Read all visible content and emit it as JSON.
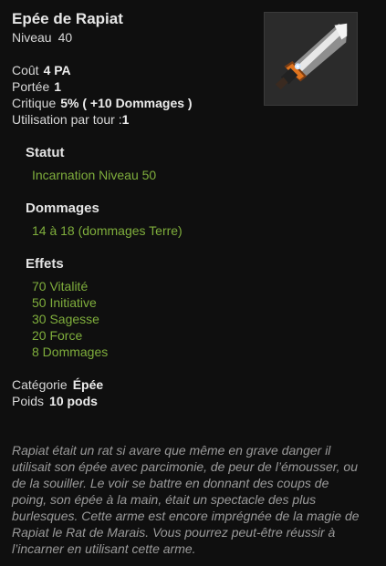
{
  "item": {
    "name": "Epée de Rapiat",
    "level_label": "Niveau",
    "level_value": "40",
    "image_icon": "sword-icon"
  },
  "stats": {
    "cost_label": "Coût",
    "cost_value": "4 PA",
    "range_label": "Portée",
    "range_value": "1",
    "critical_label": "Critique",
    "critical_value": "5% ( +10 Dommages )",
    "uses_label": "Utilisation par tour :",
    "uses_value": "1"
  },
  "status": {
    "heading": "Statut",
    "value": "Incarnation Niveau 50"
  },
  "damage": {
    "heading": "Dommages",
    "value": "14 à 18 (dommages Terre)"
  },
  "effects": {
    "heading": "Effets",
    "items": [
      "70 Vitalité",
      "50 Initiative",
      "30 Sagesse",
      "20 Force",
      "8 Dommages"
    ]
  },
  "meta": {
    "category_label": "Catégorie",
    "category_value": "Épée",
    "weight_label": "Poids",
    "weight_value": "10 pods"
  },
  "description": "Rapiat était un rat si avare que même en grave danger il utilisait son épée avec parcimonie, de peur de l’émousser, ou de la souiller. Le voir se battre en donnant des coups de poing, son épée à la main, était un spectacle des plus burlesques. Cette arme est encore imprégnée de la magie de Rapiat le Rat de Marais. Vous pourrez peut-être réussir à l’incarner en utilisant cette arme.",
  "colors": {
    "background": "#0f0f0f",
    "effect_green": "#7fae3c",
    "description_gray": "#9a9a9a"
  }
}
